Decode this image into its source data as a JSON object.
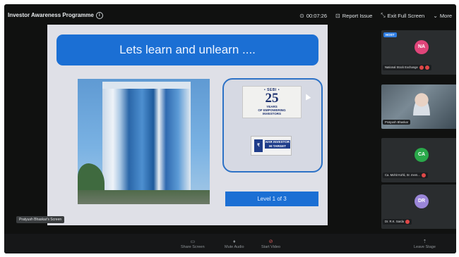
{
  "topbar": {
    "title": "Investor Awareness Programme",
    "info_icon": "info-icon",
    "timer": "00:07:26",
    "report_label": "Report Issue",
    "exit_label": "Exit Full Screen",
    "more_label": "More"
  },
  "slide": {
    "title": "Lets learn and unlearn ....",
    "logo25": {
      "top": "• SEBI •",
      "number": "25",
      "tag1": "YEARS",
      "tag2": "OF EMPOWERING",
      "tag3": "INVESTORS"
    },
    "logo_invest": {
      "mark": "₹",
      "line1": "HAR INVESTOR",
      "line2": "HI TARGET"
    },
    "level_text": "Level 1 of 3"
  },
  "screen_label": "Pratyush Bhaskar's Screen",
  "participants": [
    {
      "host_badge": "HOST",
      "initials": "NA",
      "name": "National Stock Exchange",
      "avatar_color": "#e0457a"
    },
    {
      "name": "Pratyush Bhaskar"
    },
    {
      "initials": "CA",
      "name": "Ca. Mohit Kohli, Sr. mem...",
      "avatar_color": "#2aa84a"
    },
    {
      "initials": "DR",
      "name": "Dr. R.K. Sarda",
      "avatar_color": "#9a86d8"
    }
  ],
  "controls": {
    "share": "Share Screen",
    "mute": "Mute Audio",
    "video": "Start Video",
    "leave": "Leave Stage"
  }
}
